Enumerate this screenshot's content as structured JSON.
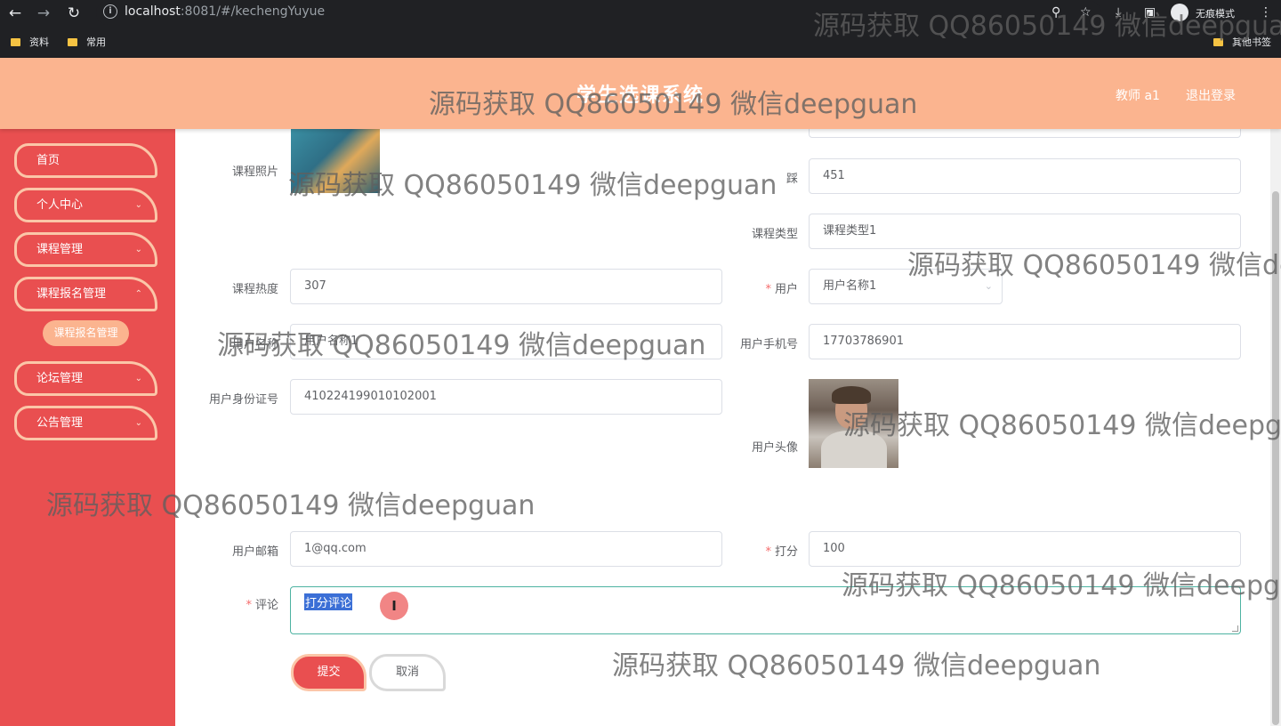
{
  "browser": {
    "url_host": "localhost",
    "url_rest": ":8081/#/kechengYuyue",
    "incognito_label": "无痕模式",
    "bookmarks": [
      "资料",
      "常用"
    ],
    "other_bookmarks": "其他书签"
  },
  "header": {
    "title": "学生选课系统",
    "user_label": "教师 a1",
    "logout_label": "退出登录"
  },
  "sidebar": {
    "items": [
      {
        "label": "首页"
      },
      {
        "label": "个人中心"
      },
      {
        "label": "课程管理"
      },
      {
        "label": "课程报名管理"
      },
      {
        "label": "论坛管理"
      },
      {
        "label": "公告管理"
      }
    ],
    "active_sub": "课程报名管理"
  },
  "form": {
    "course_photo_label": "课程照片",
    "clicks_label": "踩",
    "clicks_value": "451",
    "course_type_label": "课程类型",
    "course_type_value": "课程类型1",
    "hot_label": "课程热度",
    "hot_value": "307",
    "user_label": "用户",
    "user_value": "用户名称1",
    "username_label": "用户名称",
    "username_value": "用户名称1",
    "phone_label": "用户手机号",
    "phone_value": "17703786901",
    "idcard_label": "用户身份证号",
    "idcard_value": "410224199010102001",
    "avatar_label": "用户头像",
    "email_label": "用户邮箱",
    "email_value": "1@qq.com",
    "score_label": "打分",
    "score_value": "100",
    "comment_label": "评论",
    "comment_value": "打分评论",
    "submit_label": "提交",
    "cancel_label": "取消"
  },
  "watermark": "源码获取 QQ86050149 微信deepguan"
}
